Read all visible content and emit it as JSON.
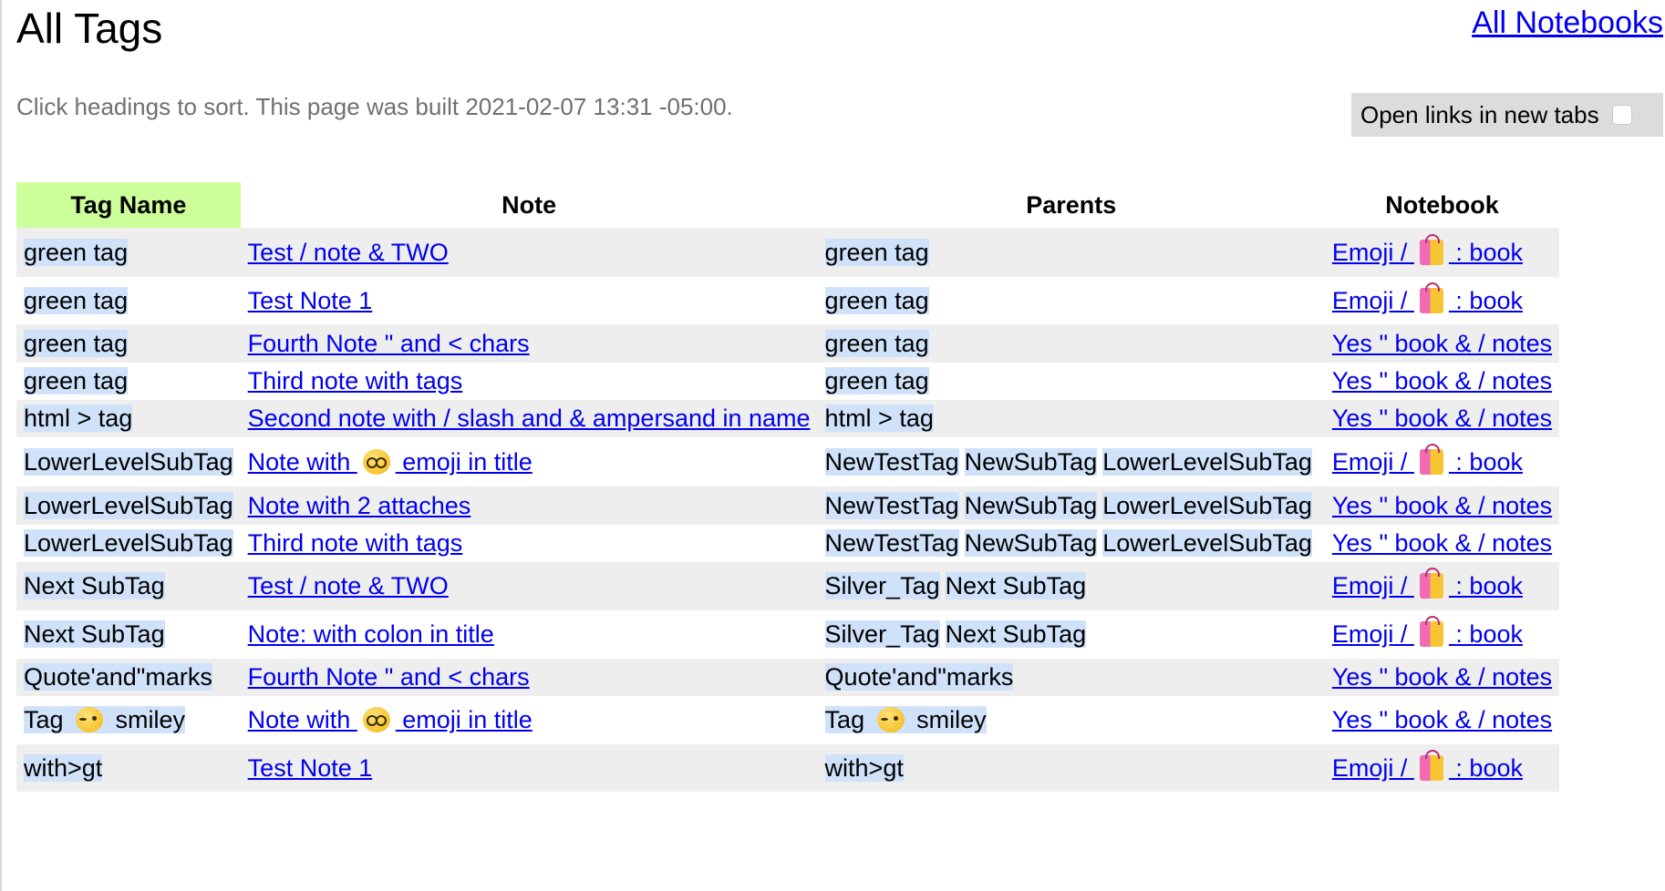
{
  "page": {
    "title": "All Tags",
    "notebooks_link": "All Notebooks",
    "subtitle": "Click headings to sort. This page was built 2021-02-07 13:31 -05:00.",
    "open_new_tabs_label": "Open links in new tabs",
    "open_new_tabs_checked": false
  },
  "table": {
    "headers": [
      "Tag Name",
      "Note",
      "Parents",
      "Notebook"
    ],
    "sorted_column": "Tag Name",
    "rows": [
      {
        "tag": "green tag",
        "note": "Test / note & TWO",
        "parents": [
          "green tag"
        ],
        "notebook": "Emoji / 🛍 : book"
      },
      {
        "tag": "green tag",
        "note": "Test Note 1",
        "parents": [
          "green tag"
        ],
        "notebook": "Emoji / 🛍 : book"
      },
      {
        "tag": "green tag",
        "note": "Fourth Note \" and < chars",
        "parents": [
          "green tag"
        ],
        "notebook": "Yes \" book & / notes"
      },
      {
        "tag": "green tag",
        "note": "Third note with tags",
        "parents": [
          "green tag"
        ],
        "notebook": "Yes \" book & / notes"
      },
      {
        "tag": "html > tag",
        "note": "Second note with / slash and & ampersand in name",
        "parents": [
          "html > tag"
        ],
        "notebook": "Yes \" book & / notes"
      },
      {
        "tag": "LowerLevelSubTag",
        "note": "Note with 🤓 emoji in title",
        "parents": [
          "NewTestTag",
          "NewSubTag",
          "LowerLevelSubTag"
        ],
        "notebook": "Emoji / 🛍 : book"
      },
      {
        "tag": "LowerLevelSubTag",
        "note": "Note with 2 attaches",
        "parents": [
          "NewTestTag",
          "NewSubTag",
          "LowerLevelSubTag"
        ],
        "notebook": "Yes \" book & / notes"
      },
      {
        "tag": "LowerLevelSubTag",
        "note": "Third note with tags",
        "parents": [
          "NewTestTag",
          "NewSubTag",
          "LowerLevelSubTag"
        ],
        "notebook": "Yes \" book & / notes"
      },
      {
        "tag": "Next SubTag",
        "note": "Test / note & TWO",
        "parents": [
          "Silver_Tag",
          "Next SubTag"
        ],
        "notebook": "Emoji / 🛍 : book"
      },
      {
        "tag": "Next SubTag",
        "note": "Note: with colon in title",
        "parents": [
          "Silver_Tag",
          "Next SubTag"
        ],
        "notebook": "Emoji / 🛍 : book"
      },
      {
        "tag": "Quote'and\"marks",
        "note": "Fourth Note \" and < chars",
        "parents": [
          "Quote'and\"marks"
        ],
        "notebook": "Yes \" book & / notes"
      },
      {
        "tag": "Tag 😉 smiley",
        "note": "Note with 🤓 emoji in title",
        "parents": [
          "Tag 😉 smiley"
        ],
        "notebook": "Yes \" book & / notes"
      },
      {
        "tag": "with>gt",
        "note": "Test Note 1",
        "parents": [
          "with>gt"
        ],
        "notebook": "Emoji / 🛍 : book"
      }
    ]
  }
}
